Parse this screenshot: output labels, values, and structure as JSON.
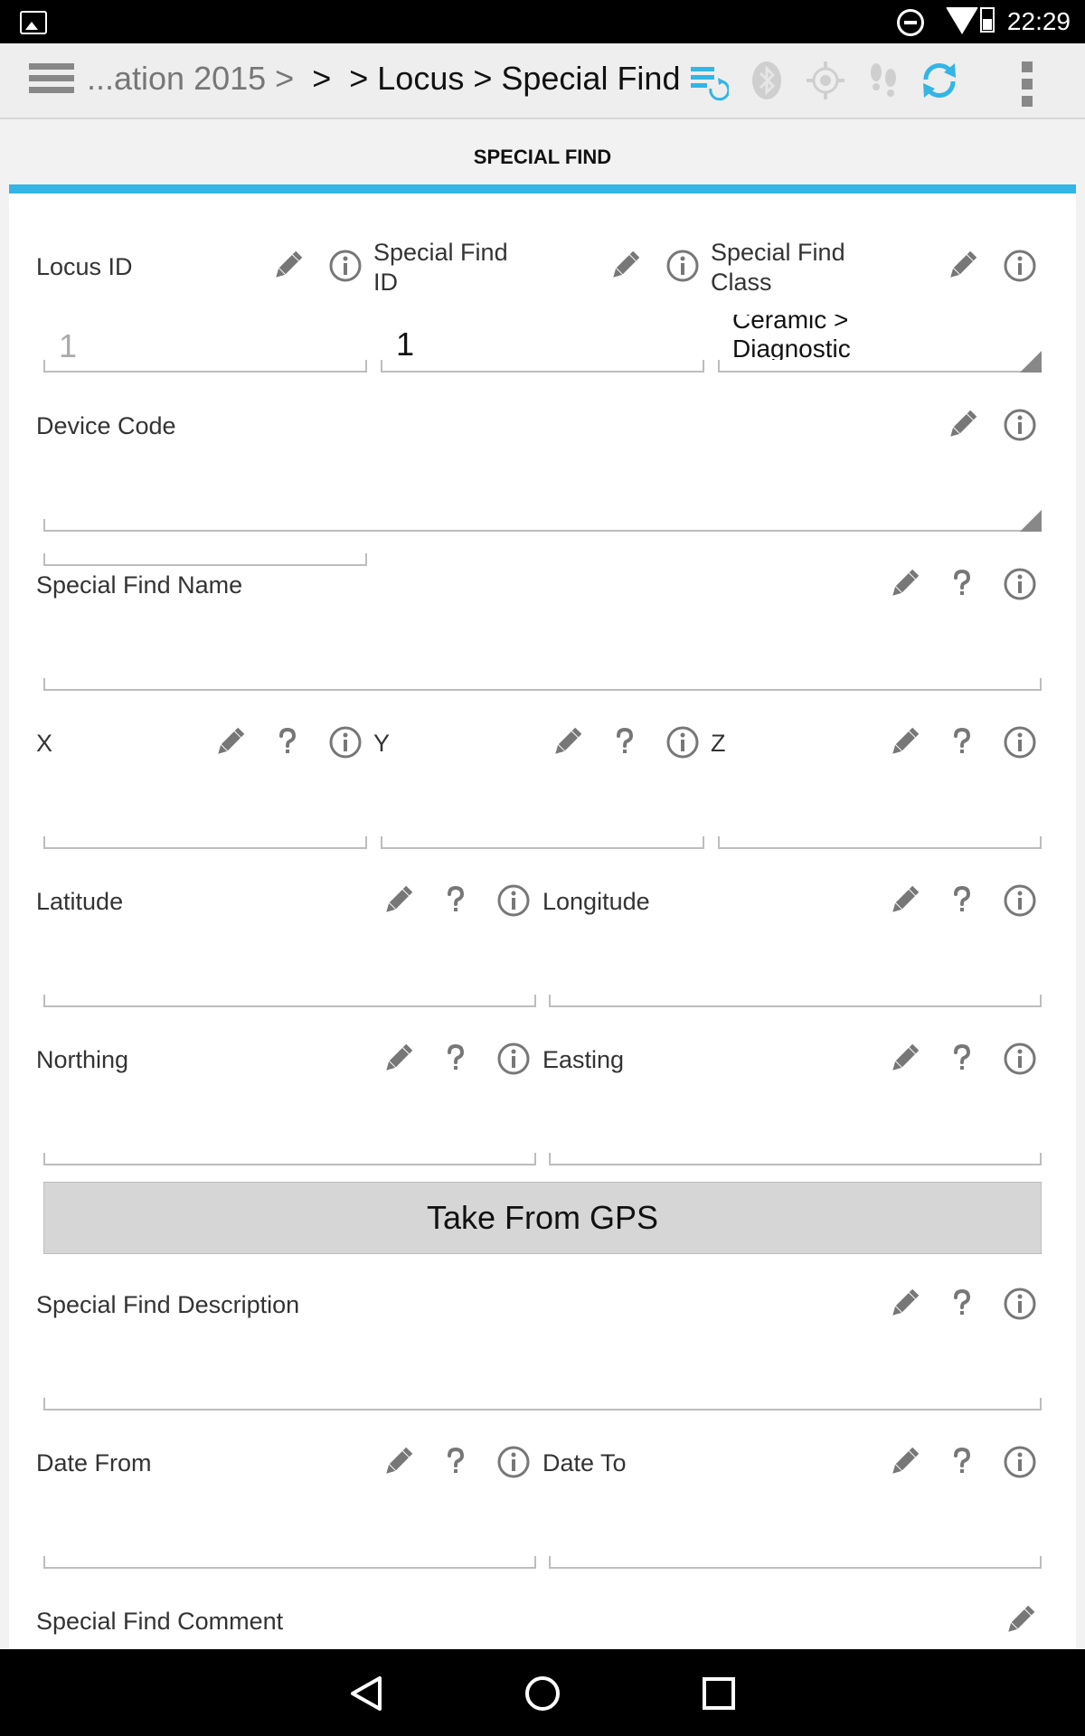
{
  "status": {
    "time": "22:29"
  },
  "toolbar": {
    "crumb_start": "...ation 2015 >",
    "crumb_mid": ">",
    "crumb_end": "> Locus > Special Find"
  },
  "form": {
    "title": "SPECIAL FIND",
    "locus_id": {
      "label": "Locus ID",
      "value": "1"
    },
    "special_find_id": {
      "label": "Special Find ID",
      "value": "1"
    },
    "special_find_class": {
      "label": "Special Find Class",
      "value_line1": "Ceramic >",
      "value_line2": "Diagnostic"
    },
    "device_code": {
      "label": "Device Code"
    },
    "special_find_name": {
      "label": "Special Find Name"
    },
    "x": {
      "label": "X"
    },
    "y": {
      "label": "Y"
    },
    "z": {
      "label": "Z"
    },
    "latitude": {
      "label": "Latitude"
    },
    "longitude": {
      "label": "Longitude"
    },
    "northing": {
      "label": "Northing"
    },
    "easting": {
      "label": "Easting"
    },
    "take_gps": "Take From GPS",
    "description": {
      "label": "Special Find Description"
    },
    "date_from": {
      "label": "Date From"
    },
    "date_to": {
      "label": "Date To"
    },
    "comment": {
      "label": "Special Find Comment"
    }
  },
  "help_mark": "?",
  "colors": {
    "accent": "#33b5e5",
    "icon_gray": "#777777"
  }
}
